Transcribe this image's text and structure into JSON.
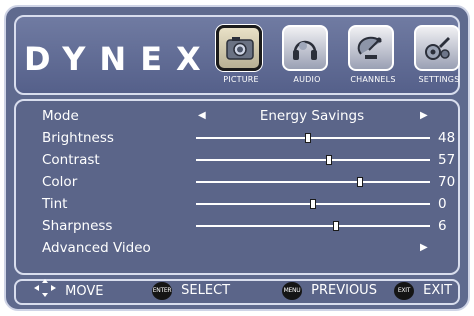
{
  "brand": {
    "logo_text": "DYNEX"
  },
  "tabs": [
    {
      "label": "PICTURE",
      "icon": "picture-icon",
      "active": true
    },
    {
      "label": "AUDIO",
      "icon": "audio-icon",
      "active": false
    },
    {
      "label": "CHANNELS",
      "icon": "channels-icon",
      "active": false
    },
    {
      "label": "SETTINGS",
      "icon": "settings-icon",
      "active": false
    }
  ],
  "menu": {
    "mode": {
      "label": "Mode",
      "value": "Energy Savings"
    },
    "brightness": {
      "label": "Brightness",
      "value": "48",
      "level": 0.48
    },
    "contrast": {
      "label": "Contrast",
      "value": "57",
      "level": 0.57
    },
    "color": {
      "label": "Color",
      "value": "70",
      "level": 0.7
    },
    "tint": {
      "label": "Tint",
      "value": "0",
      "level": 0.5
    },
    "sharpness": {
      "label": "Sharpness",
      "value": "6",
      "level": 0.6
    },
    "advanced": {
      "label": "Advanced Video"
    }
  },
  "footer": {
    "move": {
      "label": "MOVE",
      "icon": "dpad-icon"
    },
    "select": {
      "button": "ENTER",
      "label": "SELECT"
    },
    "previous": {
      "button": "MENU",
      "label": "PREVIOUS"
    },
    "exit": {
      "button": "EXIT",
      "label": "EXIT"
    }
  },
  "colors": {
    "panel": "#5b6589",
    "text": "#ffffff",
    "active_tab_border": "#1b1b1b"
  }
}
